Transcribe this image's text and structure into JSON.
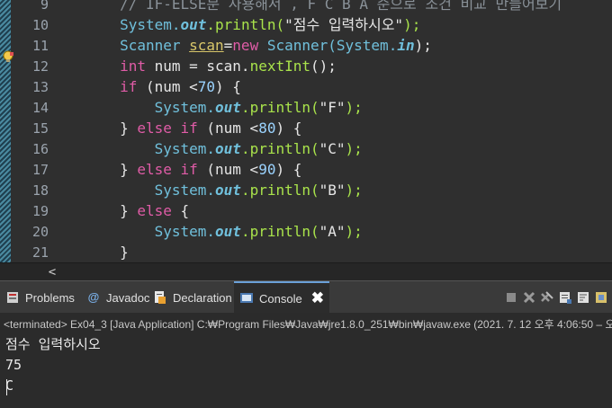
{
  "editor": {
    "lines": [
      {
        "num": "9",
        "tokens": [
          [
            "c-comment",
            "        // IF-ELSE문 사용해서 , F C B A 순으로 조건 비교 만들어보기"
          ]
        ]
      },
      {
        "num": "10",
        "tokens": [
          [
            "c-type",
            "        System."
          ],
          [
            "c-field",
            "out"
          ],
          [
            "c-method",
            ".println("
          ],
          [
            "c-string",
            "\"점수 입력하시오\""
          ],
          [
            "c-method",
            ");"
          ]
        ]
      },
      {
        "num": "11",
        "tokens": [
          [
            "c-type",
            "        Scanner "
          ],
          [
            "c-warn",
            "scan"
          ],
          [
            "",
            "="
          ],
          [
            "c-keyword",
            "new "
          ],
          [
            "c-type",
            "Scanner(System."
          ],
          [
            "c-field",
            "in"
          ],
          [
            "",
            "); "
          ]
        ]
      },
      {
        "num": "12",
        "tokens": [
          [
            "c-keyword",
            "        int "
          ],
          [
            "",
            "num = scan."
          ],
          [
            "c-method",
            "nextInt"
          ],
          [
            "",
            "();"
          ]
        ]
      },
      {
        "num": "13",
        "tokens": [
          [
            "c-keyword",
            "        if "
          ],
          [
            "",
            "(num <"
          ],
          [
            "c-num",
            "70"
          ],
          [
            "",
            ") {"
          ]
        ]
      },
      {
        "num": "14",
        "tokens": [
          [
            "c-type",
            "            System."
          ],
          [
            "c-field",
            "out"
          ],
          [
            "c-method",
            ".println("
          ],
          [
            "c-string",
            "\"F\""
          ],
          [
            "c-method",
            ");"
          ]
        ]
      },
      {
        "num": "15",
        "tokens": [
          [
            "",
            "        } "
          ],
          [
            "c-keyword",
            "else if "
          ],
          [
            "",
            "(num <"
          ],
          [
            "c-num",
            "80"
          ],
          [
            "",
            ") {"
          ]
        ]
      },
      {
        "num": "16",
        "tokens": [
          [
            "c-type",
            "            System."
          ],
          [
            "c-field",
            "out"
          ],
          [
            "c-method",
            ".println("
          ],
          [
            "c-string",
            "\"C\""
          ],
          [
            "c-method",
            ");"
          ]
        ]
      },
      {
        "num": "17",
        "tokens": [
          [
            "",
            "        } "
          ],
          [
            "c-keyword",
            "else if "
          ],
          [
            "",
            "(num <"
          ],
          [
            "c-num",
            "90"
          ],
          [
            "",
            ") {"
          ]
        ]
      },
      {
        "num": "18",
        "tokens": [
          [
            "c-type",
            "            System."
          ],
          [
            "c-field",
            "out"
          ],
          [
            "c-method",
            ".println("
          ],
          [
            "c-string",
            "\"B\""
          ],
          [
            "c-method",
            ");"
          ]
        ]
      },
      {
        "num": "19",
        "tokens": [
          [
            "",
            "        } "
          ],
          [
            "c-keyword",
            "else "
          ],
          [
            "",
            "{"
          ]
        ]
      },
      {
        "num": "20",
        "tokens": [
          [
            "c-type",
            "            System."
          ],
          [
            "c-field",
            "out"
          ],
          [
            "c-method",
            ".println("
          ],
          [
            "c-string",
            "\"A\""
          ],
          [
            "c-method",
            ");"
          ]
        ]
      },
      {
        "num": "21",
        "tokens": [
          [
            "",
            "        }"
          ]
        ]
      }
    ]
  },
  "tabs": {
    "problems": "Problems",
    "javadoc": "Javadoc",
    "declaration": "Declaration",
    "console": "Console",
    "close": "✖"
  },
  "console": {
    "status_line": "<terminated> Ex04_3 [Java Application] C:₩Program Files₩Java₩jre1.8.0_251₩bin₩javaw.exe  (2021. 7. 12 오후 4:06:50 – 오",
    "output": [
      "점수 입력하시오",
      "75",
      "C"
    ]
  },
  "scroll": {
    "left_arrow": "<"
  },
  "colors": {
    "accent": "#6aa0d8",
    "editor_bg": "#2f2f2f",
    "console_bg": "#2b2b2b"
  }
}
